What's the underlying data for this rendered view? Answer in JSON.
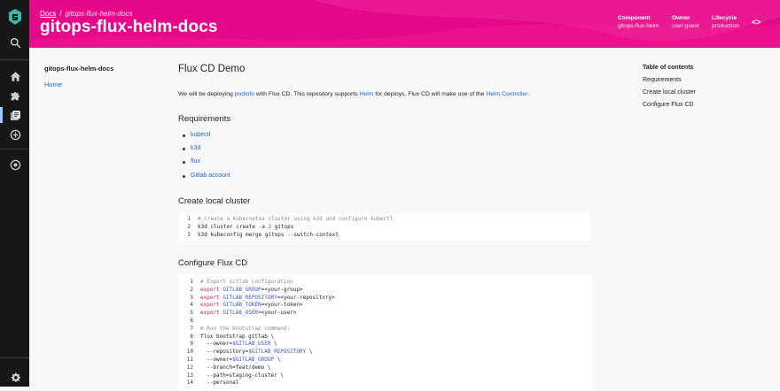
{
  "sidebar": {
    "items": [
      {
        "icon": "search-icon"
      },
      {
        "icon": "home-icon"
      },
      {
        "icon": "puzzle-icon"
      },
      {
        "icon": "docs-icon"
      },
      {
        "icon": "add-circle-icon"
      },
      {
        "icon": "radar-icon"
      },
      {
        "icon": "gear-icon"
      }
    ]
  },
  "header": {
    "breadcrumb_root": "Docs",
    "breadcrumb_separator": "/",
    "breadcrumb_current": "gitops-flux-helm-docs",
    "title": "gitops-flux-helm-docs",
    "meta": [
      {
        "label": "Component",
        "value": "gitops-flux-helm"
      },
      {
        "label": "Owner",
        "value": "user:guest"
      },
      {
        "label": "Lifecycle",
        "value": "production"
      }
    ],
    "code_toggle": "<>"
  },
  "left_nav": {
    "title": "gitops-flux-helm-docs",
    "home_link": "Home"
  },
  "content": {
    "h1": "Flux CD Demo",
    "intro": {
      "p1": "We will be deploying ",
      "link1": "podinfo",
      "p2": " with Flux CD. This repository supports ",
      "link2": "Helm",
      "p3": " for deploys. Flux CD will make use of the ",
      "link3": "Helm Controller",
      "p4": "."
    },
    "requirements_heading": "Requirements",
    "requirements": [
      "kubectl",
      "k3d",
      "flux",
      "Gitlab account"
    ],
    "create_heading": "Create local cluster",
    "create_code": [
      {
        "n": "1",
        "comment": "# Create a Kubernetes cluster using k3d and configure kubectl"
      },
      {
        "n": "2",
        "pre": "k3d cluster create -a ",
        "num": "2",
        "post": " gitops"
      },
      {
        "n": "3",
        "plain": "k3d kubeconfig merge gitops --switch-context"
      }
    ],
    "configure_heading": "Configure Flux CD",
    "configure_code": [
      {
        "n": "1",
        "comment": "# Export Gitlab configuration"
      },
      {
        "n": "2",
        "kw": "export",
        "var": "GITLAB_GROUP",
        "rest": "=<your-group>"
      },
      {
        "n": "3",
        "kw": "export",
        "var": "GITLAB_REPOSITORY",
        "rest": "=<your-repository>"
      },
      {
        "n": "4",
        "kw": "export",
        "var": "GITLAB_TOKEN",
        "rest": "=<your-token>"
      },
      {
        "n": "5",
        "kw": "export",
        "var": "GITLAB_USER",
        "rest": "=<your-user>"
      },
      {
        "n": "6",
        "plain": ""
      },
      {
        "n": "7",
        "comment": "# Run the bootstrap command:"
      },
      {
        "n": "8",
        "plain": "flux bootstrap gitlab \\"
      },
      {
        "n": "9",
        "pre": "  --owner=",
        "var": "$GITLAB_USER",
        "post": " \\"
      },
      {
        "n": "10",
        "pre": "  --repository=",
        "var": "$GITLAB_REPOSITORY",
        "post": " \\"
      },
      {
        "n": "11",
        "pre": "  --owner=",
        "var": "$GITLAB_GROUP",
        "post": " \\"
      },
      {
        "n": "12",
        "plain": "  --branch=feat/demo \\"
      },
      {
        "n": "13",
        "plain": "  --path=staging-cluster \\"
      },
      {
        "n": "14",
        "plain": "  --personal"
      }
    ]
  },
  "toc": {
    "title": "Table of contents",
    "items": [
      "Requirements",
      "Create local cluster",
      "Configure Flux CD"
    ]
  },
  "colors": {
    "header": "#e5088b",
    "sidebar": "#171717",
    "link": "#2563c9",
    "accent": "#9cc9ff"
  }
}
